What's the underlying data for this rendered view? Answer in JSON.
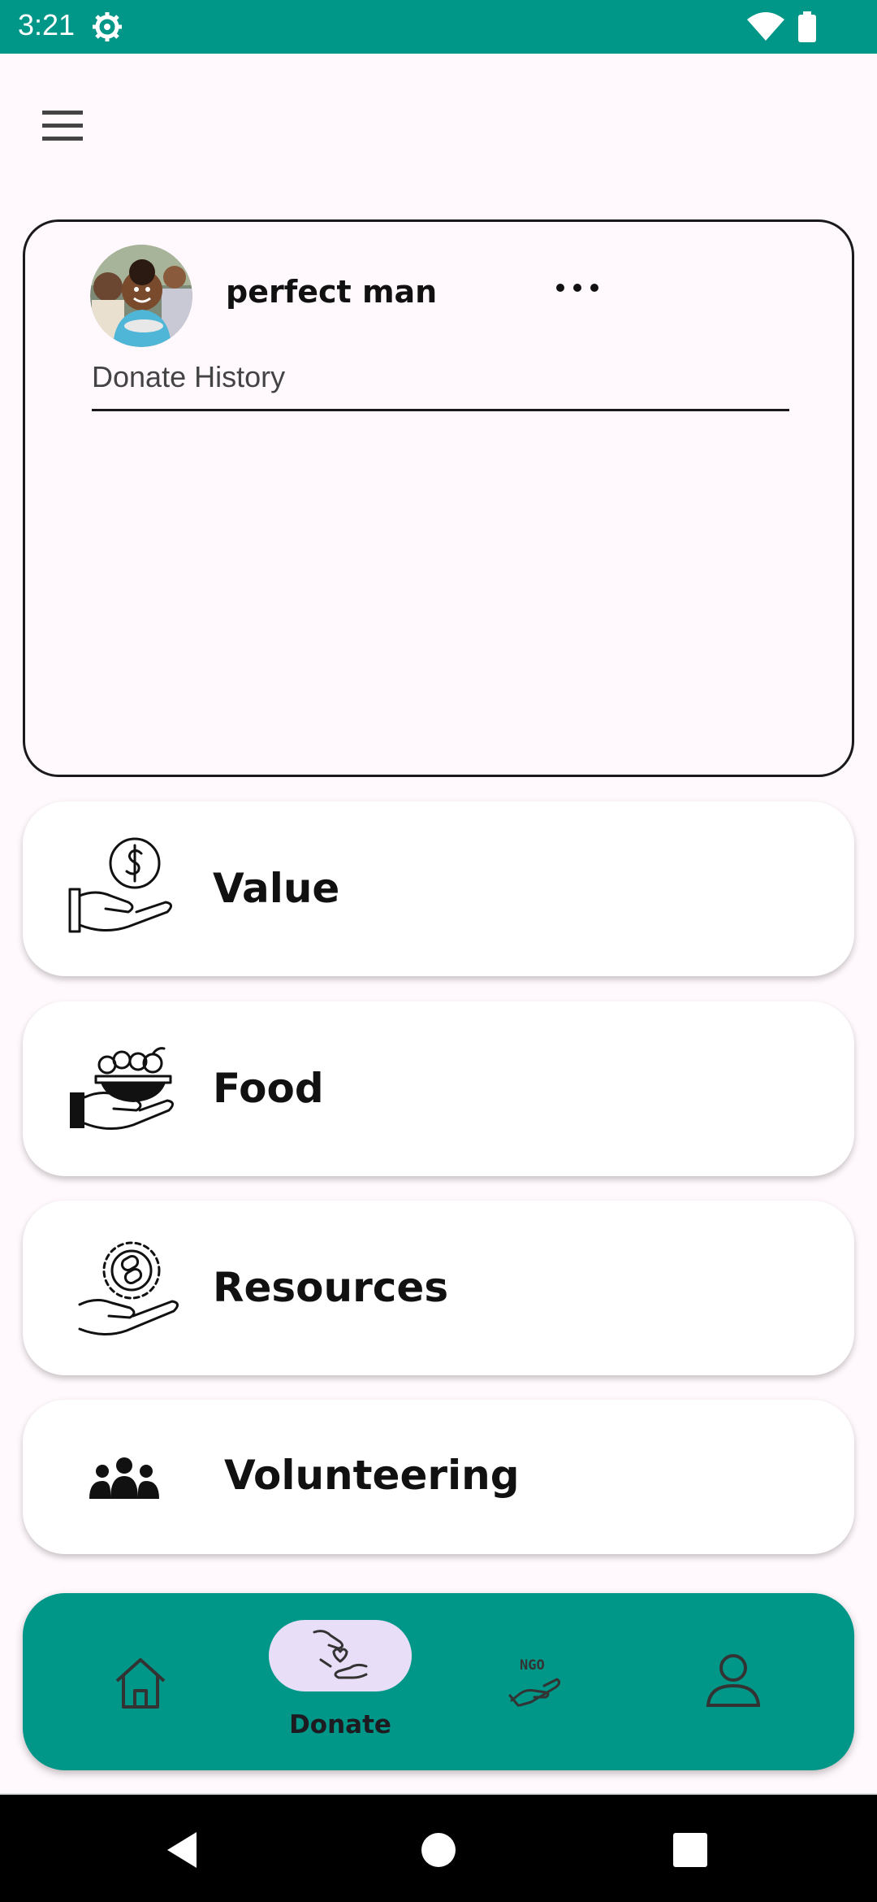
{
  "status_bar": {
    "time": "3:21",
    "background": "#009688"
  },
  "header": {
    "menu_icon": "hamburger-menu-icon"
  },
  "profile": {
    "name": "perfect man",
    "history_label": "Donate History",
    "more_icon": "more-horizontal-icon"
  },
  "donate_options": [
    {
      "label": "Value",
      "icon": "hand-dollar-icon"
    },
    {
      "label": "Food",
      "icon": "hand-food-basket-icon"
    },
    {
      "label": "Resources",
      "icon": "hand-resources-icon"
    },
    {
      "label": "Volunteering",
      "icon": "people-group-icon"
    }
  ],
  "bottom_nav": {
    "items": [
      {
        "icon": "home-icon",
        "label": ""
      },
      {
        "icon": "donate-hands-icon",
        "label": "Donate",
        "selected": true
      },
      {
        "icon": "ngo-hand-icon",
        "label": ""
      },
      {
        "icon": "profile-person-icon",
        "label": ""
      }
    ],
    "background": "#009688",
    "selected_pill": "#E8DEF8"
  },
  "system_nav": {
    "icons": [
      "back-icon",
      "home-circle-icon",
      "recents-icon"
    ]
  }
}
